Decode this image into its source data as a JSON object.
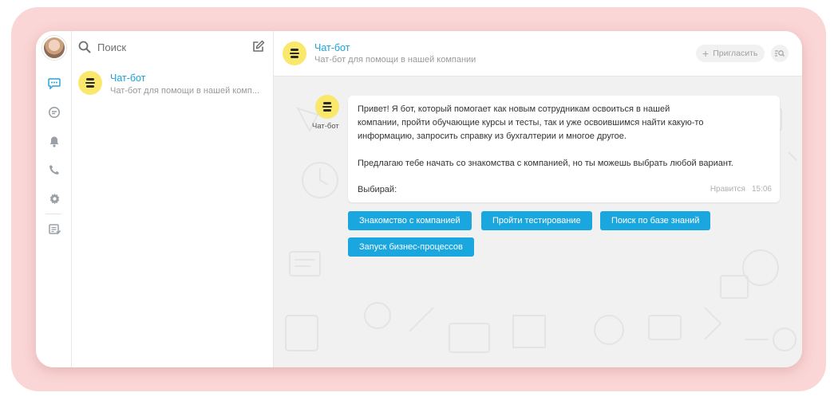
{
  "sidebar": {
    "icons": [
      "chat-icon",
      "channels-icon",
      "bell-icon",
      "phone-icon",
      "settings-icon",
      "tasks-icon"
    ]
  },
  "chat_list": {
    "search_placeholder": "Поиск",
    "items": [
      {
        "name": "Чат-бот",
        "preview": "Чат-бот для помощи в нашей комп..."
      }
    ]
  },
  "header": {
    "title": "Чат-бот",
    "subtitle": "Чат-бот для помощи в нашей компании",
    "invite_label": "Пригласить"
  },
  "message": {
    "sender": "Чат-бот",
    "paragraph1": "Привет! Я бот, который помогает как новым сотрудникам освоиться в нашей\nкомпании, пройти обучающие курсы и тесты, так и уже освоившимся найти какую-то\nинформацию, запросить справку из бухгалтерии и многое другое.",
    "paragraph2": "Предлагаю тебе начать со знакомства с компанией, но ты можешь выбрать любой вариант.",
    "paragraph3": "Выбирай:",
    "like_label": "Нравится",
    "time": "15:06"
  },
  "actions": [
    "Знакомство с компанией",
    "Пройти тестирование",
    "Поиск по базе знаний",
    "Запуск бизнес-процессов"
  ],
  "colors": {
    "accent": "#1aa6df",
    "bot_avatar": "#f9e86c",
    "frame": "#fbd6d6",
    "chat_bg": "#f1f1f1"
  }
}
